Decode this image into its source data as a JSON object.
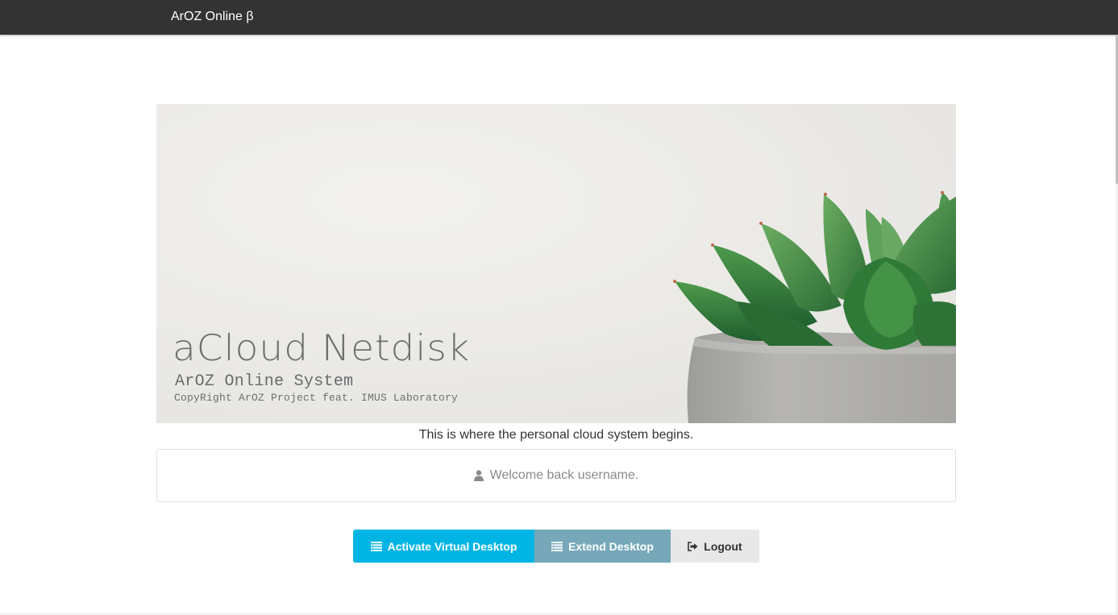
{
  "navbar": {
    "brand": "ArOZ Online β"
  },
  "banner": {
    "title": "aCloud Netdisk",
    "subtitle": "ArOZ Online System",
    "copyright": "CopyRight ArOZ Project feat. IMUS Laboratory"
  },
  "tagline": "This is where the personal cloud system begins.",
  "welcome": {
    "icon": "user-icon",
    "text": "Welcome back username."
  },
  "actions": {
    "activate_label": "Activate Virtual Desktop",
    "activate_icon": "desktop-list-icon",
    "extend_label": "Extend Desktop",
    "extend_icon": "desktop-list-icon",
    "logout_label": "Logout",
    "logout_icon": "sign-out-icon"
  },
  "colors": {
    "navbar_bg": "#333333",
    "primary": "#00b5e4",
    "secondary": "#76a8b9",
    "default": "#e8e8e8"
  }
}
